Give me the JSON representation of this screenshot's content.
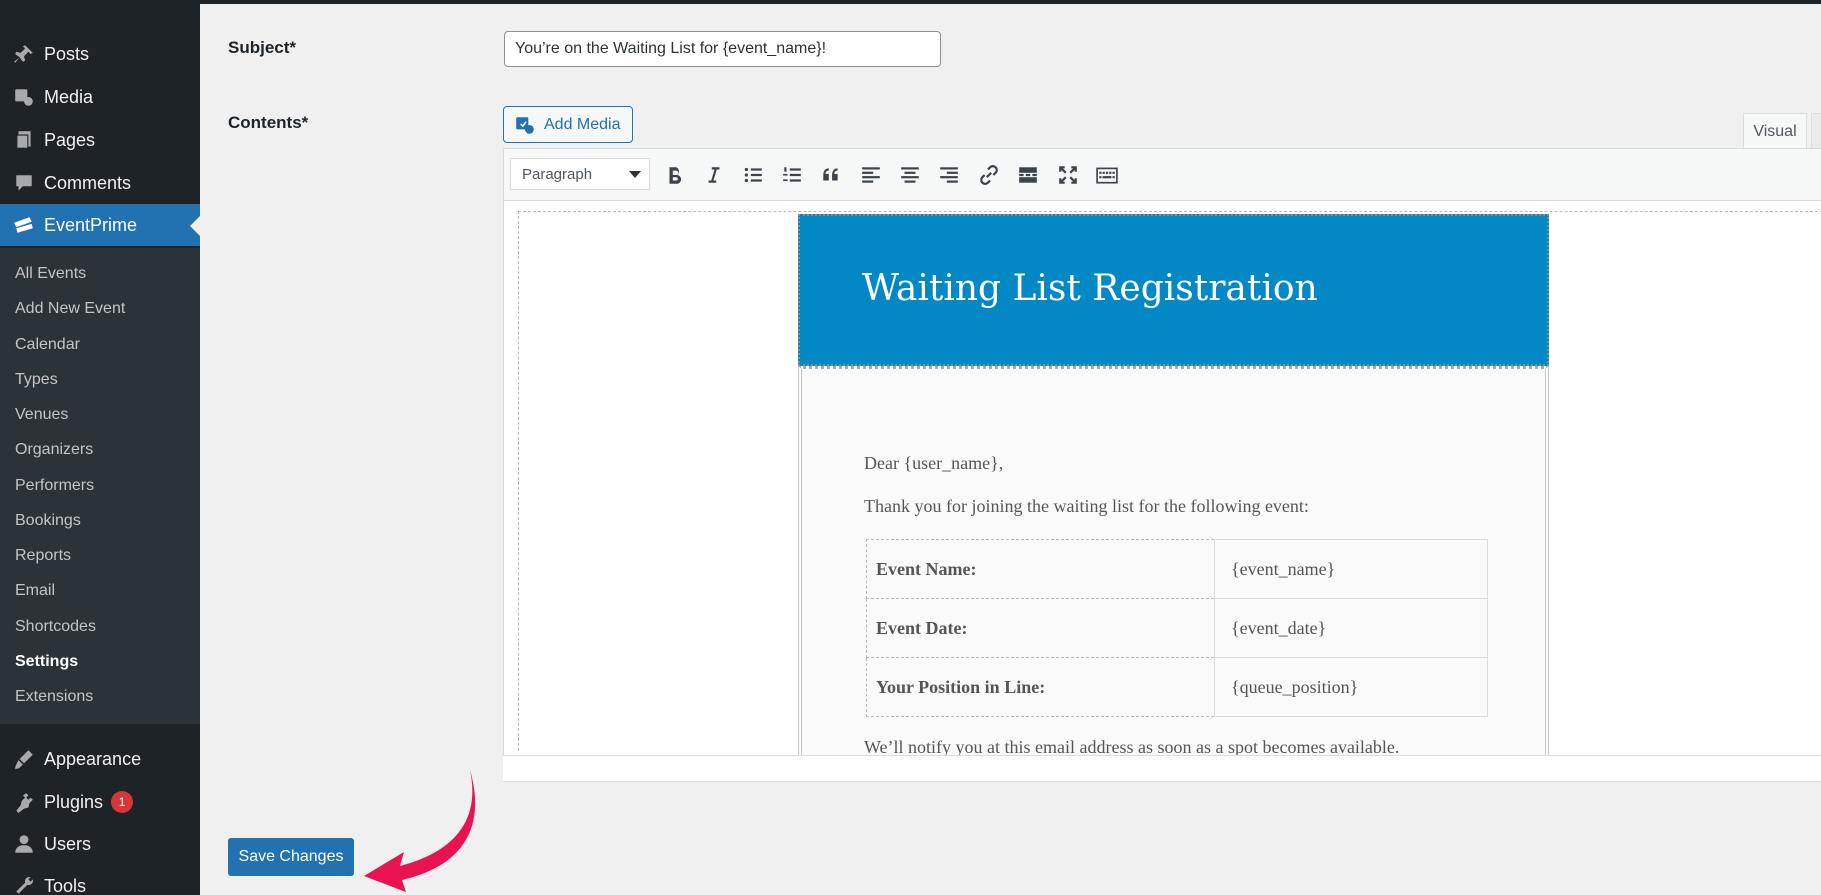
{
  "sidebar": {
    "items": [
      {
        "label": "Posts",
        "icon": "pin-icon"
      },
      {
        "label": "Media",
        "icon": "media-icon"
      },
      {
        "label": "Pages",
        "icon": "pages-icon"
      },
      {
        "label": "Comments",
        "icon": "comment-icon"
      },
      {
        "label": "EventPrime",
        "icon": "ticket-icon"
      },
      {
        "label": "Appearance",
        "icon": "brush-icon"
      },
      {
        "label": "Plugins",
        "icon": "plug-icon",
        "badge": "1"
      },
      {
        "label": "Users",
        "icon": "user-icon"
      },
      {
        "label": "Tools",
        "icon": "wrench-icon"
      }
    ],
    "submenu": [
      "All Events",
      "Add New Event",
      "Calendar",
      "Types",
      "Venues",
      "Organizers",
      "Performers",
      "Bookings",
      "Reports",
      "Email",
      "Shortcodes",
      "Settings",
      "Extensions"
    ],
    "active_item": "EventPrime",
    "current_submenu": "Settings"
  },
  "form": {
    "subject_label": "Subject*",
    "subject_value": "You’re on the Waiting List for {event_name}!",
    "contents_label": "Contents*",
    "add_media_label": "Add Media",
    "tab_visual": "Visual",
    "format_select": "Paragraph"
  },
  "toolbar": {
    "buttons": [
      "bold-icon",
      "italic-icon",
      "bullet-list-icon",
      "numbered-list-icon",
      "blockquote-icon",
      "align-left-icon",
      "align-center-icon",
      "align-right-icon",
      "link-icon",
      "read-more-icon",
      "fullscreen-icon",
      "toolbar-toggle-icon"
    ]
  },
  "email": {
    "title": "Waiting List Registration",
    "greeting": "Dear {user_name},",
    "intro": "Thank you for joining the waiting list for the following event:",
    "rows": [
      {
        "key": "Event Name:",
        "value": "{event_name}"
      },
      {
        "key": "Event Date:",
        "value": "{event_date}"
      },
      {
        "key": "Your Position in Line:",
        "value": "{queue_position}"
      }
    ],
    "footer": "We’ll notify you at this email address as soon as a spot becomes available.",
    "header_color": "#0288c4"
  },
  "save_button": "Save Changes",
  "colors": {
    "accent": "#2271b1",
    "arrow": "#e8134f",
    "sidebar": "#1d2327"
  }
}
